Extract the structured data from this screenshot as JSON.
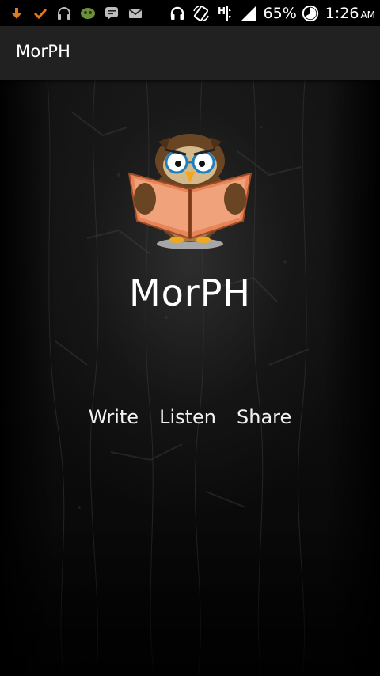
{
  "status_bar": {
    "notification_icons": [
      "download-icon",
      "check-icon",
      "headphones-icon",
      "game-icon",
      "messenger-icon",
      "gmail-icon"
    ],
    "system_icons": [
      "headset-icon",
      "rotate-icon",
      "network-h-icon",
      "signal-icon"
    ],
    "battery_percent": "65%",
    "time": "1:26",
    "ampm": "AM"
  },
  "action_bar": {
    "title": "MorPH"
  },
  "main": {
    "logo_icon": "owl-reading-book-icon",
    "app_name": "MorPH",
    "menu": [
      {
        "label": "Write"
      },
      {
        "label": "Listen"
      },
      {
        "label": "Share"
      }
    ]
  },
  "colors": {
    "action_bar_bg": "#212121",
    "status_bar_bg": "#000000",
    "text": "#ffffff",
    "download_icon": "#e07a1f"
  }
}
